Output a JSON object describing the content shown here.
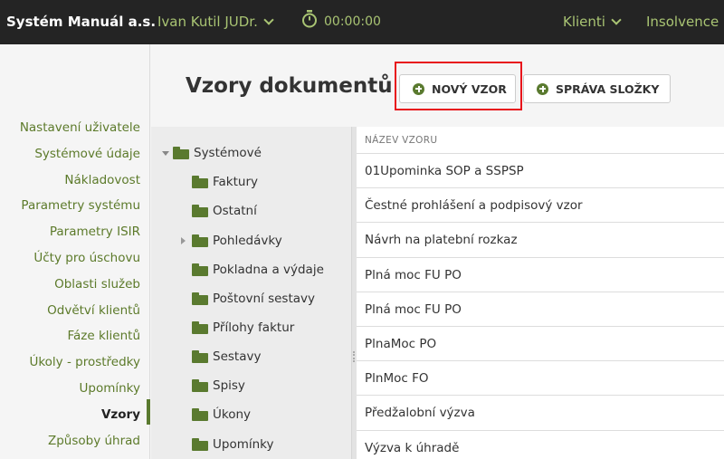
{
  "header": {
    "brand": "Systém Manuál a.s.",
    "user": "Ivan Kutil JUDr.",
    "timer": "00:00:00",
    "nav": [
      {
        "label": "Klienti"
      },
      {
        "label": "Insolvence"
      }
    ]
  },
  "sidebar": {
    "items": [
      {
        "label": "Nastavení uživatele"
      },
      {
        "label": "Systémové údaje"
      },
      {
        "label": "Nákladovost"
      },
      {
        "label": "Parametry systému"
      },
      {
        "label": "Parametry ISIR"
      },
      {
        "label": "Účty pro úschovu"
      },
      {
        "label": "Oblasti služeb"
      },
      {
        "label": "Odvětví klientů"
      },
      {
        "label": "Fáze klientů"
      },
      {
        "label": "Úkoly - prostředky"
      },
      {
        "label": "Upomínky"
      },
      {
        "label": "Vzory"
      },
      {
        "label": "Způsoby úhrad"
      }
    ],
    "active": "Vzory"
  },
  "page": {
    "title": "Vzory dokumentů",
    "new_button": "NOVÝ VZOR",
    "manage_button": "SPRÁVA SLOŽKY"
  },
  "tree": {
    "root": "Systémové",
    "children": [
      {
        "label": "Faktury"
      },
      {
        "label": "Ostatní"
      },
      {
        "label": "Pohledávky"
      },
      {
        "label": "Pokladna a výdaje"
      },
      {
        "label": "Poštovní sestavy"
      },
      {
        "label": "Přílohy faktur"
      },
      {
        "label": "Sestavy"
      },
      {
        "label": "Spisy"
      },
      {
        "label": "Úkony"
      },
      {
        "label": "Upomínky"
      }
    ]
  },
  "table": {
    "header": "NÁZEV VZORU",
    "rows": [
      "01Upominka SOP a SSPSP",
      "Čestné prohlášení a podpisový vzor",
      "Návrh na platební rozkaz",
      "Plná moc FU PO",
      "Plná moc FU PO",
      "PlnaMoc PO",
      "PlnMoc FO",
      "Předžalobní výzva",
      "Výzva k úhradě"
    ]
  },
  "colors": {
    "accent": "#5a7a2f",
    "link": "#5c7a2a",
    "topbar": "#242424",
    "highlight": "#e8141b"
  }
}
